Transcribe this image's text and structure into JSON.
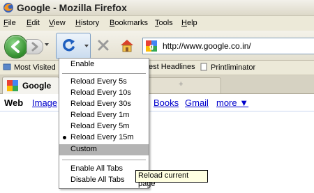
{
  "window": {
    "title": "Google - Mozilla Firefox"
  },
  "menubar": [
    "File",
    "Edit",
    "View",
    "History",
    "Bookmarks",
    "Tools",
    "Help"
  ],
  "navbar": {
    "url": "http://www.google.co.in/"
  },
  "bookmarks": {
    "most_visited": "Most Visited",
    "latest_headlines": "est Headlines",
    "printliminator": "Printliminator"
  },
  "tabs": {
    "active_label": "Google",
    "new_tab": "+"
  },
  "google_nav": {
    "web": "Web",
    "images": "Images",
    "books": "Books",
    "gmail": "Gmail",
    "more": "more ▼"
  },
  "reload_menu": {
    "enable": "Enable",
    "intervals": [
      "Reload Every 5s",
      "Reload Every 10s",
      "Reload Every 30s",
      "Reload Every 1m",
      "Reload Every 5m",
      "Reload Every 15m"
    ],
    "selected_index": 5,
    "custom": "Custom",
    "enable_all": "Enable All Tabs",
    "disable_all": "Disable All Tabs"
  },
  "tooltip": "Reload current page",
  "colors": {
    "accent_blue": "#1f5fbf",
    "back_green": "#2f8b2a",
    "link": "#0000cc"
  }
}
